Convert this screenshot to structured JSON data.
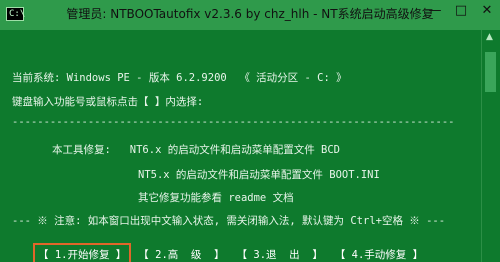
{
  "window": {
    "title": "管理员: NTBOOTautofix v2.3.6 by chz_hlh - NT系统启动高级修复",
    "icon_label": "C:\\",
    "controls": {
      "minimize": "—",
      "maximize": "□",
      "close": "✕"
    }
  },
  "console": {
    "system_line": "当前系统: Windows PE - 版本 6.2.9200  《 活动分区 - C: 》",
    "prompt_line": "键盘输入功能号或鼠标点击【 】内选择:",
    "divider": "----------------------------------------------------------------------",
    "tool_line_1": "本工具修复:   NT6.x 的启动文件和启动菜单配置文件 BCD",
    "tool_line_2": "NT5.x 的启动文件和启动菜单配置文件 BOOT.INI",
    "tool_line_3": "其它修复功能参看 readme 文档",
    "notice_line": "--- ※ 注意: 如本窗口出现中文输入状态, 需关闭输入法, 默认键为 Ctrl+空格 ※ ---"
  },
  "menu": [
    {
      "label": "【 1.开始修复 】",
      "selected": true
    },
    {
      "label": "【 2.高  级  】",
      "selected": false
    },
    {
      "label": "【 3.退  出  】",
      "selected": false
    },
    {
      "label": "【 4.手动修复 】",
      "selected": false
    }
  ]
}
